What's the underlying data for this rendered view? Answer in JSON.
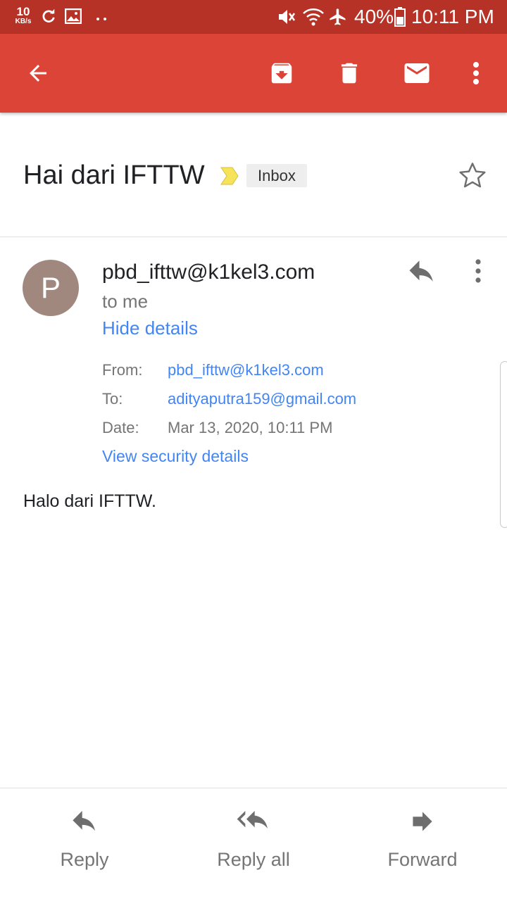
{
  "status_bar": {
    "speed_value": "10",
    "speed_unit": "KB/s",
    "battery": "40%",
    "time": "10:11 PM"
  },
  "toolbar": {
    "icons": [
      "back-arrow-icon",
      "archive-icon",
      "delete-icon",
      "mark-unread-icon",
      "more-vert-icon"
    ]
  },
  "email": {
    "subject": "Hai dari IFTTW",
    "label": "Inbox",
    "sender": "pbd_ifttw@k1kel3.com",
    "avatar_letter": "P",
    "recipient_summary": "to me",
    "hide_details": "Hide details",
    "details": {
      "from_label": "From:",
      "from_value": "pbd_ifttw@k1kel3.com",
      "to_label": "To:",
      "to_value": "adityaputra159@gmail.com",
      "date_label": "Date:",
      "date_value": "Mar 13, 2020, 10:11 PM"
    },
    "security_link": "View security details",
    "body": "Halo dari IFTTW."
  },
  "actions": {
    "reply": "Reply",
    "reply_all": "Reply all",
    "forward": "Forward"
  },
  "colors": {
    "status_bar": "#b73226",
    "app_bar": "#db4437",
    "link": "#4285f4",
    "avatar": "#a1887f",
    "importance": "#f7e35a"
  }
}
